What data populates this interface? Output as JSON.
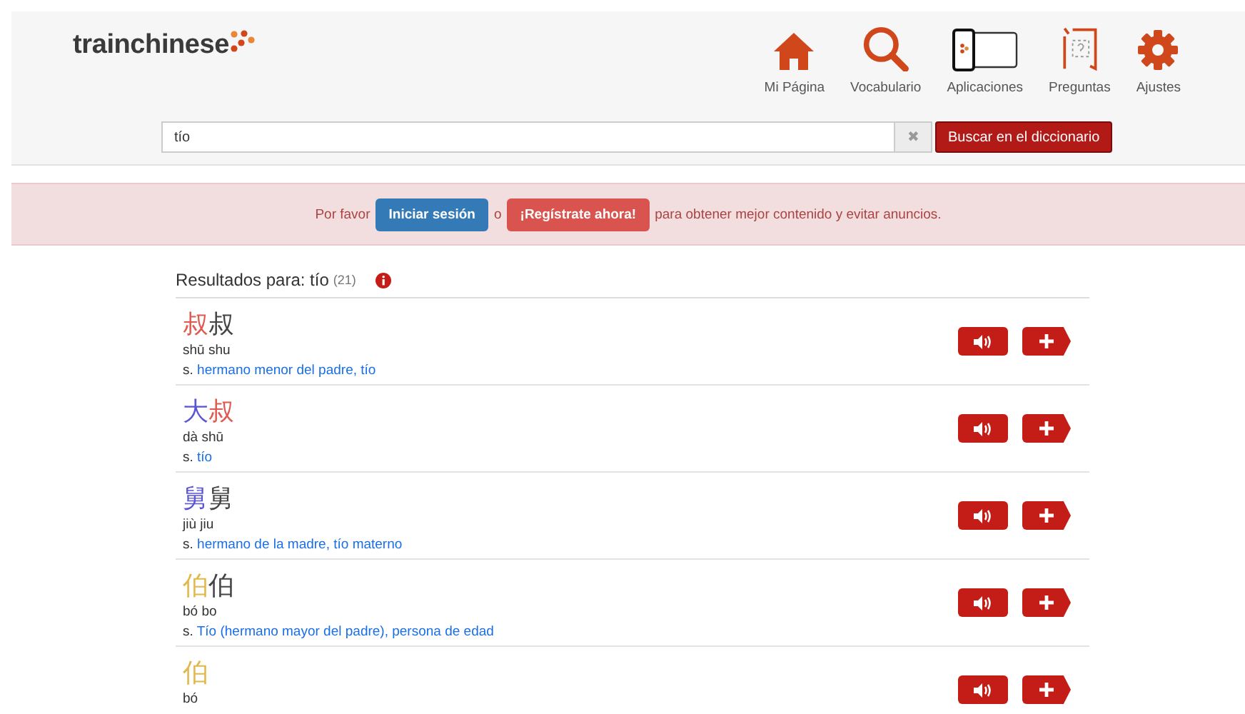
{
  "logo": {
    "text": "trainchinese"
  },
  "nav": [
    {
      "kind": "home",
      "label": "Mi Página"
    },
    {
      "kind": "search",
      "label": "Vocabulario"
    },
    {
      "kind": "devices",
      "label": "Aplicaciones"
    },
    {
      "kind": "question",
      "label": "Preguntas"
    },
    {
      "kind": "settings",
      "label": "Ajustes"
    }
  ],
  "search": {
    "value": "tío",
    "clear": "✖",
    "button": "Buscar en el diccionario"
  },
  "notice": {
    "before": "Por favor",
    "login": "Iniciar sesión",
    "middle": "o",
    "register": "¡Regístrate ahora!",
    "after": "para obtener mejor contenido y evitar anuncios."
  },
  "results": {
    "title": "Resultados para: tío",
    "count": "(21)"
  },
  "entries": [
    {
      "chars": [
        {
          "text": "叔",
          "color": "#e05a50"
        },
        {
          "text": "叔",
          "color": "#444444"
        }
      ],
      "pinyin": "shū shu",
      "pos": "s.",
      "definition": "hermano menor del padre, tío"
    },
    {
      "chars": [
        {
          "text": "大",
          "color": "#5a55d6"
        },
        {
          "text": "叔",
          "color": "#e05a50"
        }
      ],
      "pinyin": "dà shū",
      "pos": "s.",
      "definition": "tío"
    },
    {
      "chars": [
        {
          "text": "舅",
          "color": "#5a55d6"
        },
        {
          "text": "舅",
          "color": "#444444"
        }
      ],
      "pinyin": "jiù jiu",
      "pos": "s.",
      "definition": "hermano de la madre, tío materno"
    },
    {
      "chars": [
        {
          "text": "伯",
          "color": "#e2b84a"
        },
        {
          "text": "伯",
          "color": "#444444"
        }
      ],
      "pinyin": "bó bo",
      "pos": "s.",
      "definition": "Tío (hermano mayor del padre), persona de edad"
    },
    {
      "chars": [
        {
          "text": "伯",
          "color": "#e2b84a"
        }
      ],
      "pinyin": "bó"
    }
  ]
}
